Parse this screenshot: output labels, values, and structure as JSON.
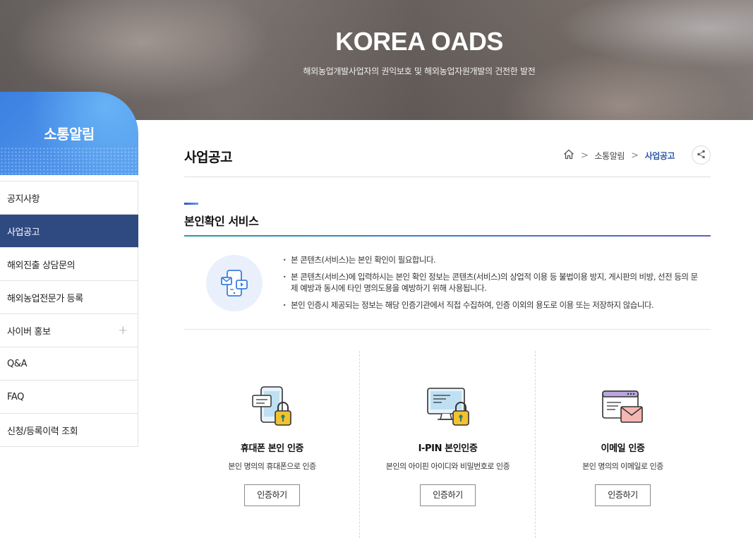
{
  "hero": {
    "title": "KOREA OADS",
    "subtitle": "해외농업개발사업자의 권익보호 및 해외농업자원개발의 건전한 발전"
  },
  "sidebar": {
    "title": "소통알림",
    "items": [
      {
        "label": "공지사항",
        "active": false
      },
      {
        "label": "사업공고",
        "active": true
      },
      {
        "label": "해외진출 상담문의",
        "active": false
      },
      {
        "label": "해외농업전문가 등록",
        "active": false
      },
      {
        "label": "사이버 홍보",
        "active": false,
        "expand": "+"
      },
      {
        "label": "Q&A",
        "active": false
      },
      {
        "label": "FAQ",
        "active": false
      },
      {
        "label": "신청/등록이력 조회",
        "active": false
      }
    ]
  },
  "page": {
    "title": "사업공고",
    "breadcrumb": [
      "소통알림",
      "사업공고"
    ],
    "breadcrumb_sep": ">"
  },
  "section": {
    "title": "본인확인 서비스",
    "notes": [
      "본 콘텐츠(서비스)는 본인 확인이 필요합니다.",
      "본 콘텐츠(서비스)에 입력하시는 본인 확인 정보는 콘텐츠(서비스)의 상업적 이용 등 불법이용 방지, 게시판의 비방, 선전 등의 문제 예방과 동시에 타인 명의도용을 예방하기 위해 사용됩니다.",
      "본인 인증시 제공되는 정보는 해당 인증기관에서 직접 수집하여, 인증 이외의 용도로 이용 또는 저장하지 않습니다."
    ]
  },
  "cards": [
    {
      "icon": "phone-lock-icon",
      "title": "휴대폰 본인 인증",
      "desc": "본인 명의의 휴대폰으로 인증",
      "button": "인증하기"
    },
    {
      "icon": "monitor-lock-icon",
      "title": "I-PIN 본인인증",
      "desc": "본인의 아이핀 아이디와 비밀번호로 인증",
      "button": "인증하기"
    },
    {
      "icon": "email-window-icon",
      "title": "이메일 인증",
      "desc": "본인 명의의 이메일로 인증",
      "button": "인증하기"
    }
  ],
  "colors": {
    "sidebar_active": "#2f4a80",
    "breadcrumb_current": "#2f5aa8",
    "accent_blue": "#3b7fe0",
    "lock_yellow": "#f2c230"
  }
}
